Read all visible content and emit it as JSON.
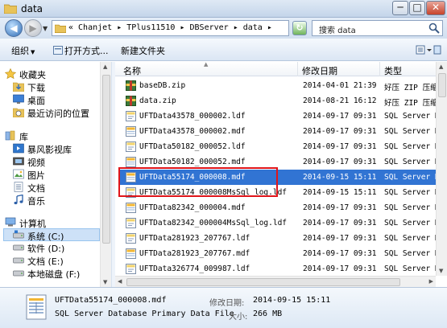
{
  "window": {
    "title": "data",
    "min_label": "─",
    "max_label": "□",
    "close_label": "✕"
  },
  "address": {
    "crumbs": "« Chanjet ▸ TPlus11510 ▸ DBServer ▸ data ▸",
    "search_placeholder": "搜索 data"
  },
  "toolbar": {
    "organize": "组织",
    "open_with": "打开方式...",
    "new_folder": "新建文件夹"
  },
  "nav": {
    "favorites": "收藏夹",
    "downloads": "下载",
    "desktop": "桌面",
    "recent": "最近访问的位置",
    "libraries": "库",
    "storm": "暴风影视库",
    "videos": "视频",
    "pictures": "图片",
    "documents": "文档",
    "music": "音乐",
    "computer": "计算机",
    "drive_c": "系统 (C:)",
    "drive_d": "软件 (D:)",
    "drive_e": "文档 (E:)",
    "drive_f": "本地磁盘 (F:)"
  },
  "columns": {
    "name": "名称",
    "modified": "修改日期",
    "type": "类型"
  },
  "files": [
    {
      "name": "baseDB.zip",
      "date": "2014-04-01 21:39",
      "type": "好压 ZIP 压缩",
      "icon": "zip-archive-icon"
    },
    {
      "name": "data.zip",
      "date": "2014-08-21 16:12",
      "type": "好压 ZIP 压缩",
      "icon": "zip-archive-icon"
    },
    {
      "name": "UFTData43578_000002.ldf",
      "date": "2014-09-17 09:31",
      "type": "SQL Server D",
      "icon": "sql-log-file-icon"
    },
    {
      "name": "UFTData43578_000002.mdf",
      "date": "2014-09-17 09:31",
      "type": "SQL Server D",
      "icon": "sql-data-file-icon"
    },
    {
      "name": "UFTData50182_000052.ldf",
      "date": "2014-09-17 09:31",
      "type": "SQL Server D",
      "icon": "sql-log-file-icon"
    },
    {
      "name": "UFTData50182_000052.mdf",
      "date": "2014-09-17 09:31",
      "type": "SQL Server D",
      "icon": "sql-data-file-icon"
    },
    {
      "name": "UFTData55174_000008.mdf",
      "date": "2014-09-15 15:11",
      "type": "SQL Server D",
      "icon": "sql-data-file-icon"
    },
    {
      "name": "UFTData55174_000008MsSql_log.ldf",
      "date": "2014-09-15 15:11",
      "type": "SQL Server D",
      "icon": "sql-log-file-icon"
    },
    {
      "name": "UFTData82342_000004.mdf",
      "date": "2014-09-17 09:31",
      "type": "SQL Server D",
      "icon": "sql-data-file-icon"
    },
    {
      "name": "UFTData82342_000004MsSql_log.ldf",
      "date": "2014-09-17 09:31",
      "type": "SQL Server D",
      "icon": "sql-log-file-icon"
    },
    {
      "name": "UFTData281923_207767.ldf",
      "date": "2014-09-17 09:31",
      "type": "SQL Server D",
      "icon": "sql-log-file-icon"
    },
    {
      "name": "UFTData281923_207767.mdf",
      "date": "2014-09-17 09:31",
      "type": "SQL Server D",
      "icon": "sql-data-file-icon"
    },
    {
      "name": "UFTData326774_009987.ldf",
      "date": "2014-09-17 09:31",
      "type": "SQL Server D",
      "icon": "sql-log-file-icon"
    }
  ],
  "selected_index": 6,
  "details": {
    "name": "UFTData55174_000008.mdf",
    "type": "SQL Server Database Primary Data File",
    "modified_label": "修改日期:",
    "modified_value": "2014-09-15 15:11",
    "size_label": "大小:",
    "size_value": "266 MB"
  },
  "colors": {
    "selection": "#3174d3",
    "highlight_box": "#e0151a"
  }
}
